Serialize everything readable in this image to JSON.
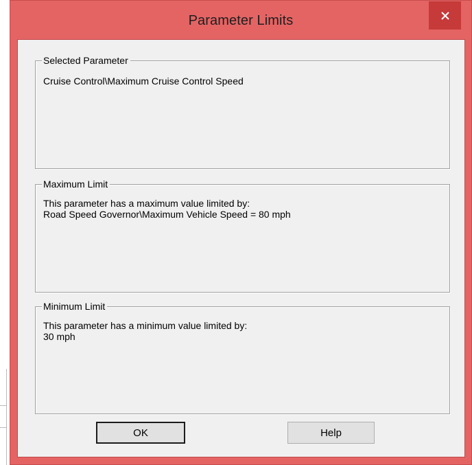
{
  "window": {
    "title": "Parameter Limits",
    "close_icon": "close-icon"
  },
  "selected_parameter": {
    "legend": "Selected Parameter",
    "value": "Cruise Control\\Maximum Cruise Control Speed"
  },
  "maximum_limit": {
    "legend": "Maximum Limit",
    "line1": "This parameter has a maximum value limited by:",
    "line2": "Road Speed Governor\\Maximum Vehicle Speed = 80 mph"
  },
  "minimum_limit": {
    "legend": "Minimum Limit",
    "line1": "This parameter has a minimum value limited by:",
    "line2": "30 mph"
  },
  "buttons": {
    "ok_label": "OK",
    "help_label": "Help"
  },
  "colors": {
    "frame": "#e46464",
    "close_button": "#c63a3a",
    "client_bg": "#f0f0f0"
  }
}
